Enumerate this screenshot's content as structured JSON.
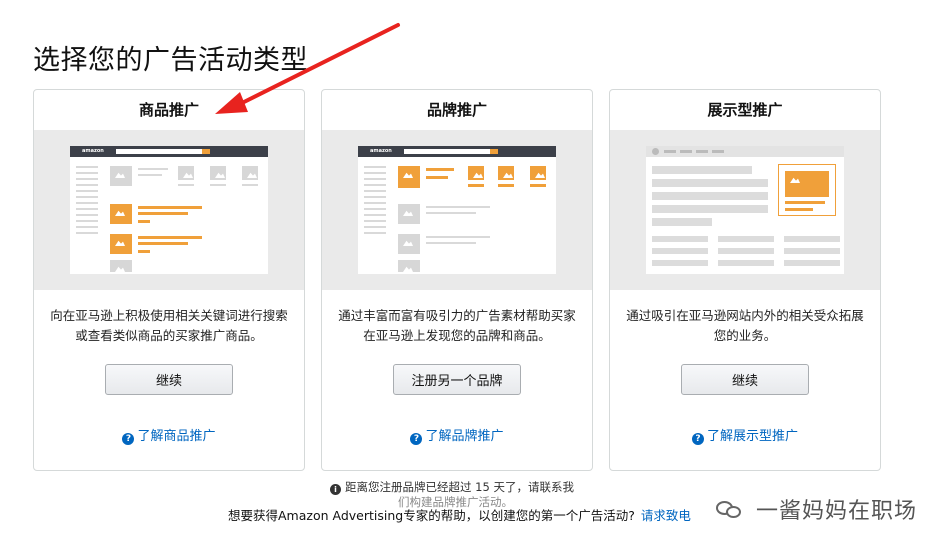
{
  "page": {
    "title": "选择您的广告活动类型"
  },
  "cards": [
    {
      "title": "商品推广",
      "desc": "向在亚马逊上积极使用相关关键词进行搜索或查看类似商品的买家推广商品。",
      "button": "继续",
      "link": "了解商品推广"
    },
    {
      "title": "品牌推广",
      "desc": "通过丰富而富有吸引力的广告素材帮助买家在亚马逊上发现您的品牌和商品。",
      "button": "注册另一个品牌",
      "link": "了解品牌推广"
    },
    {
      "title": "展示型推广",
      "desc": "通过吸引在亚马逊网站内外的相关受众拓展您的业务。",
      "button": "继续",
      "link": "了解展示型推广"
    }
  ],
  "mock": {
    "logo": "amazon"
  },
  "notice": {
    "line1": "距离您注册品牌已经超过 15 天了，请联系我",
    "line2": "们构建品牌推广活动。"
  },
  "help": {
    "text": "想要获得Amazon Advertising专家的帮助，以创建您的第一个广告活动?",
    "link": "请求致电"
  },
  "watermark": {
    "text": "一酱妈妈在职场"
  },
  "icons": {
    "help": "question-circle-icon",
    "info": "info-circle-icon"
  },
  "colors": {
    "accent": "#f0a03a",
    "link": "#0066c0",
    "arrow": "#e8231f"
  }
}
